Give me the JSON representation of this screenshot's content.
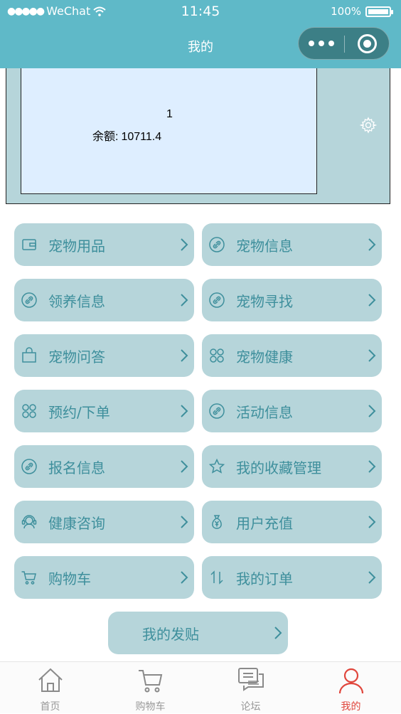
{
  "statusbar": {
    "carrier": "WeChat",
    "time": "11:45",
    "battery": "100%"
  },
  "navbar": {
    "title": "我的"
  },
  "user": {
    "name": "1",
    "balance_label": "余额:",
    "balance_value": "10711.4"
  },
  "menu": [
    {
      "label": "宠物用品",
      "icon": "wallet-icon"
    },
    {
      "label": "宠物信息",
      "icon": "link-icon"
    },
    {
      "label": "领养信息",
      "icon": "link-icon"
    },
    {
      "label": "宠物寻找",
      "icon": "link-icon"
    },
    {
      "label": "宠物问答",
      "icon": "bag-icon"
    },
    {
      "label": "宠物健康",
      "icon": "grid-icon"
    },
    {
      "label": "预约/下单",
      "icon": "grid-icon"
    },
    {
      "label": "活动信息",
      "icon": "link-icon"
    },
    {
      "label": "报名信息",
      "icon": "link-icon"
    },
    {
      "label": "我的收藏管理",
      "icon": "star-icon"
    },
    {
      "label": "健康咨询",
      "icon": "headset-icon"
    },
    {
      "label": "用户充值",
      "icon": "money-bag-icon"
    },
    {
      "label": "购物车",
      "icon": "cart-icon"
    },
    {
      "label": "我的订单",
      "icon": "sort-icon"
    }
  ],
  "post": {
    "label": "我的发贴"
  },
  "tabbar": {
    "home": "首页",
    "cart": "购物车",
    "forum": "论坛",
    "mine": "我的"
  },
  "colors": {
    "theme": "#5fb9c8",
    "card": "#b6d5da",
    "text": "#3e8f9c",
    "active": "#e0463c"
  }
}
